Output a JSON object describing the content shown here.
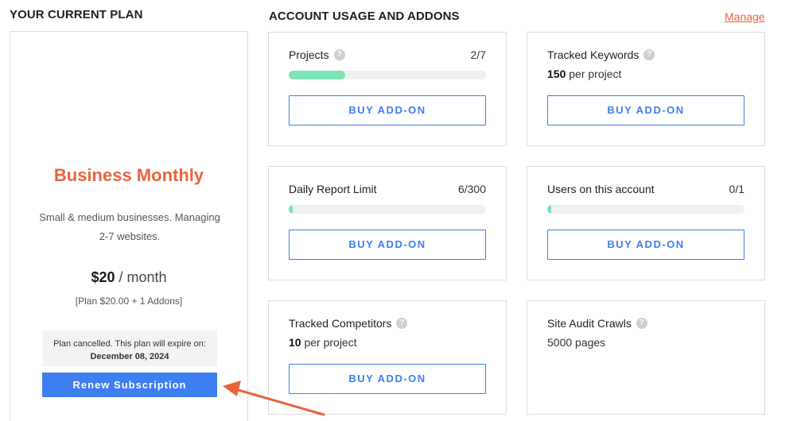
{
  "plan_section": {
    "heading": "YOUR CURRENT PLAN",
    "plan_name": "Business Monthly",
    "description": "Small & medium businesses. Managing 2-7 websites.",
    "price_amount": "$20",
    "price_period": " / month",
    "breakdown": "[Plan $20.00 + 1 Addons]",
    "notice_text": "Plan cancelled. This plan will expire on: ",
    "notice_date": "December 08, 2024",
    "renew_label": "Renew Subscription"
  },
  "usage_section": {
    "heading": "ACCOUNT USAGE AND ADDONS",
    "manage_label": "Manage",
    "buy_label": "BUY ADD-ON",
    "help_glyph": "?",
    "cards": [
      {
        "label": "Projects",
        "count": "2/7",
        "progress": 0.286
      },
      {
        "label": "Tracked Keywords",
        "value": "150",
        "unit": " per project"
      },
      {
        "label": "Daily Report Limit",
        "count": "6/300",
        "progress": 0.02
      },
      {
        "label": "Users on this account",
        "count": "0/1",
        "progress": 0.01
      },
      {
        "label": "Tracked Competitors",
        "value": "10",
        "unit": " per project"
      },
      {
        "label": "Site Audit Crawls",
        "value": "5000 pages"
      }
    ]
  },
  "colors": {
    "accent_orange": "#e8643c",
    "primary_blue": "#3d7ef0",
    "progress_green": "#7ce2b4",
    "annotation_arrow": "#e8643c"
  },
  "icons": [
    "help-icon",
    "annotation-arrow"
  ]
}
